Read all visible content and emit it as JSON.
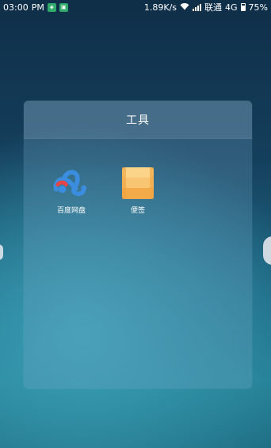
{
  "status_bar": {
    "time": "03:00",
    "ampm": "PM",
    "speed": "1.89K/s",
    "carrier": "联通",
    "network": "4G",
    "battery": "75%"
  },
  "folder": {
    "title": "工具",
    "apps": [
      {
        "label": "百度网盘",
        "icon": "baidu-netdisk-icon"
      },
      {
        "label": "便签",
        "icon": "notes-icon"
      }
    ]
  }
}
